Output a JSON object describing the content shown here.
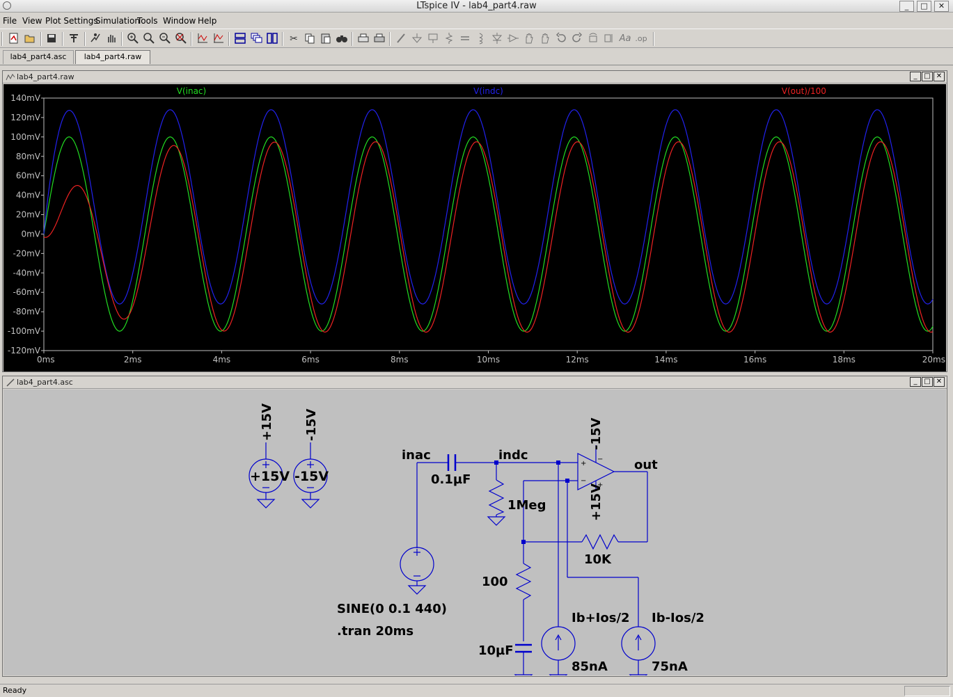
{
  "window": {
    "title": "LTspice IV - lab4_part4.raw",
    "minimize": "_",
    "maximize": "□",
    "close": "✕"
  },
  "menu": [
    "File",
    "View",
    "Plot Settings",
    "Simulation",
    "Tools",
    "Window",
    "Help"
  ],
  "toolbar_icons": [
    "new-schematic-icon",
    "open-icon",
    "save-icon",
    "control-panel-icon",
    "run-icon",
    "halt-icon",
    "zoom-area-icon",
    "zoom-in-icon",
    "zoom-out-icon",
    "zoom-fit-icon",
    "autorange-icon",
    "mark-unmark-icon",
    "tile-horizontal-icon",
    "cascade-icon",
    "tile-vertical-icon",
    "cut-icon",
    "copy-icon",
    "paste-icon",
    "find-icon",
    "print-setup-icon",
    "print-icon",
    "wire-icon",
    "ground-icon",
    "label-net-icon",
    "resistor-icon",
    "capacitor-icon",
    "inductor-icon",
    "diode-icon",
    "component-icon",
    "move-icon",
    "drag-icon",
    "undo-icon",
    "redo-icon",
    "rotate-icon",
    "mirror-icon",
    "text-icon",
    "spice-directive-icon"
  ],
  "tabs": [
    {
      "label": "lab4_part4.asc",
      "active": false
    },
    {
      "label": "lab4_part4.raw",
      "active": true
    }
  ],
  "plot_window": {
    "title": "lab4_part4.raw"
  },
  "schematic_window": {
    "title": "lab4_part4.asc"
  },
  "chart_data": {
    "type": "line",
    "x_unit": "ms",
    "xlim": [
      0,
      20
    ],
    "ylim": [
      -120,
      140
    ],
    "x_ticks": [
      "0ms",
      "2ms",
      "4ms",
      "6ms",
      "8ms",
      "10ms",
      "12ms",
      "14ms",
      "16ms",
      "18ms",
      "20ms"
    ],
    "y_ticks": [
      "140mV",
      "120mV",
      "100mV",
      "80mV",
      "60mV",
      "40mV",
      "20mV",
      "0mV",
      "-20mV",
      "-40mV",
      "-60mV",
      "-80mV",
      "-100mV",
      "-120mV"
    ],
    "y_tick_values": [
      140,
      120,
      100,
      80,
      60,
      40,
      20,
      0,
      -20,
      -40,
      -60,
      -80,
      -100,
      -120
    ],
    "background": "#000000",
    "axis_color": "#c0c0c0",
    "series": [
      {
        "name": "V(inac)",
        "color": "#22dd22",
        "frequency_hz": 440,
        "amplitude_mv": 100,
        "offset_mv": 0,
        "phase_deg": 0
      },
      {
        "name": "V(indc)",
        "color": "#2222ee",
        "frequency_hz": 440,
        "amplitude_mv": 100,
        "offset_mv": 28,
        "phase_deg": 0
      },
      {
        "name": "V(out)/100",
        "color": "#ee2222",
        "frequency_hz": 440,
        "amplitude_mv": 98,
        "offset_mv": -3,
        "phase_deg": -12
      }
    ]
  },
  "schematic": {
    "wire_color": "#0000cc",
    "text_color": "#000000",
    "labels": {
      "vpos_net": "+15V",
      "vpos_value": "+15V",
      "vneg_net": "-15V",
      "vneg_value": "-15V",
      "inac": "inac",
      "indc": "indc",
      "out": "out",
      "cap_in": "0.1µF",
      "r_1meg": "1Meg",
      "r_10k": "10K",
      "r_100": "100",
      "cap_10u": "10µF",
      "source_spec": "SINE(0 0.1 440)",
      "tran": ".tran 20ms",
      "ib_plus": "Ib+Ios/2",
      "ib_plus_value": "85nA",
      "ib_minus": "Ib-Ios/2",
      "ib_minus_value": "75nA",
      "opamp_vneg": "-15V",
      "opamp_vpos": "+15V"
    }
  },
  "status": {
    "text": "Ready"
  }
}
